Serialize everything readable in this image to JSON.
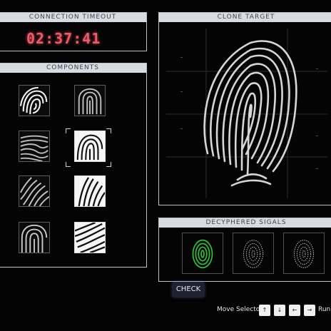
{
  "timeout": {
    "title": "CONNECTION TIMEOUT",
    "time": "02:37:41"
  },
  "components": {
    "title": "COMPONENTS",
    "items": [
      {
        "id": "comp-1",
        "pattern": "arch-swirl"
      },
      {
        "id": "comp-2",
        "pattern": "loop"
      },
      {
        "id": "comp-3",
        "pattern": "whorl"
      },
      {
        "id": "comp-4",
        "pattern": "loop-right"
      },
      {
        "id": "comp-5",
        "pattern": "diagonal"
      },
      {
        "id": "comp-6",
        "pattern": "slant"
      },
      {
        "id": "comp-7",
        "pattern": "arch"
      },
      {
        "id": "comp-8",
        "pattern": "ridge"
      }
    ],
    "selected_index": 3
  },
  "target": {
    "title": "CLONE TARGET"
  },
  "deciphered": {
    "title": "DECYPHERED SIGALS",
    "signals": [
      {
        "state": "matched",
        "color": "#2fbf3a"
      },
      {
        "state": "pending",
        "color": "#c8c8c8"
      },
      {
        "state": "pending",
        "color": "#c8c8c8"
      }
    ]
  },
  "controls": {
    "check_label": "CHECK",
    "move_selector_label": "Move Selector",
    "keys": [
      "↑",
      "↓",
      "←",
      "→"
    ],
    "run_label": "Run"
  }
}
